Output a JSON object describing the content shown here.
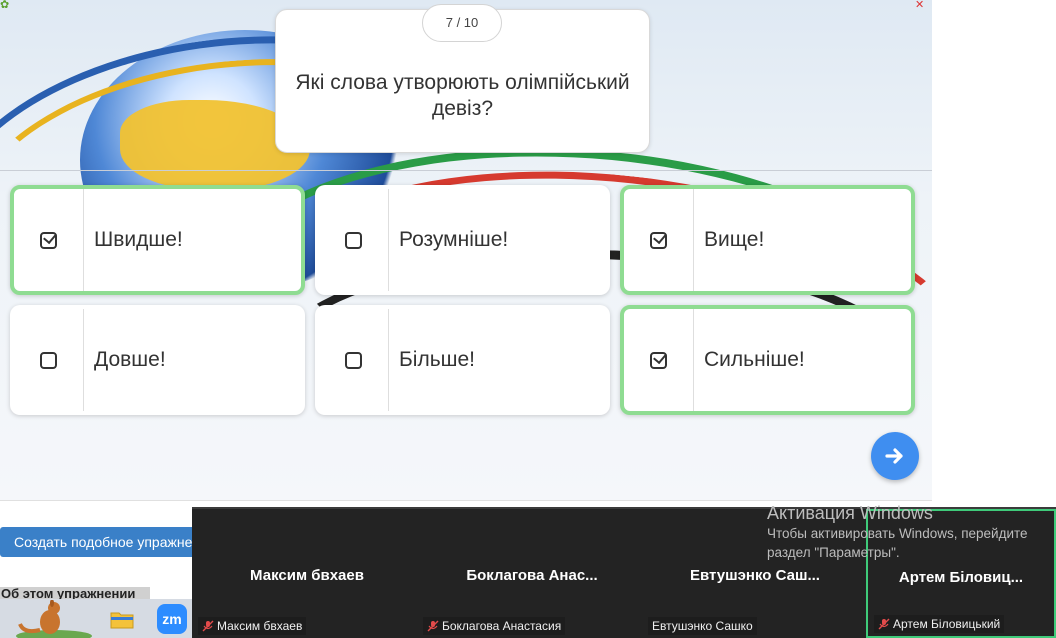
{
  "quiz": {
    "counter": "7 / 10",
    "question": "Які слова утворюють олімпійський девіз?",
    "options": [
      {
        "label": "Швидше!",
        "selected": true
      },
      {
        "label": "Розумніше!",
        "selected": false
      },
      {
        "label": "Вище!",
        "selected": true
      },
      {
        "label": "Довше!",
        "selected": false
      },
      {
        "label": "Більше!",
        "selected": false
      },
      {
        "label": "Сильніше!",
        "selected": true
      }
    ],
    "next_icon": "arrow-right-icon"
  },
  "page": {
    "create_button": "Создать подобное упражнение",
    "about_label": "Об этом упражнении"
  },
  "zoom": {
    "participants": [
      {
        "display": "Максим бвхаев",
        "tag": "Максим бвхаев",
        "muted": true
      },
      {
        "display": "Боклагова  Анас...",
        "tag": "Боклагова Анастасия",
        "muted": true
      },
      {
        "display": "Евтушэнко  Саш...",
        "tag": "Евтушэнко Сашко",
        "muted": false
      },
      {
        "display": "Артем Біловиц...",
        "tag": "Артем Біловицький",
        "muted": true,
        "active": true
      }
    ]
  },
  "windows": {
    "activation_title": "Активация Windows",
    "activation_line1": "Чтобы активировать Windows, перейдите",
    "activation_line2": "раздел \"Параметры\"."
  },
  "taskbar": {
    "zoom_label": "zm"
  },
  "colors": {
    "selected_border": "#8fdc92",
    "next_button": "#3f8ef0",
    "create_button": "#3a80c8",
    "zoom_bg": "#232323",
    "active_speaker": "#3fcb7a"
  }
}
